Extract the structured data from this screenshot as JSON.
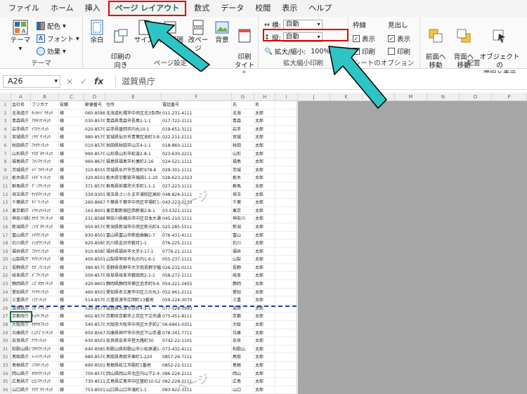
{
  "tabs": [
    "ファイル",
    "ホーム",
    "挿入",
    "ページ レイアウト",
    "数式",
    "データ",
    "校閲",
    "表示",
    "ヘルプ"
  ],
  "active_tab_index": 3,
  "ribbon": {
    "theme": {
      "label": "テーマ",
      "colors": "配色",
      "fonts": "フォント",
      "effects": "効果",
      "group": "テーマ"
    },
    "page_setup": {
      "margins": "余白",
      "orientation": "印刷の\n向き",
      "size": "サイズ",
      "print_area": "印刷範囲",
      "breaks": "改ページ",
      "background": "背景",
      "print_titles": "印刷\nタイトル",
      "group": "ページ設定"
    },
    "scale": {
      "width_label": "横:",
      "width_value": "自動",
      "height_label": "縦:",
      "height_value": "自動",
      "scale_label": "拡大/縮小:",
      "scale_value": "100%",
      "group": "拡大縮小印刷"
    },
    "sheet_options": {
      "gridlines": "枠線",
      "headings": "見出し",
      "view": "表示",
      "print": "印刷",
      "group": "シートのオプション"
    },
    "arrange": {
      "bring_forward": "前面へ\n移動",
      "send_backward": "背面へ\n移動",
      "selection_pane": "オブジェクトの\n選択と表示",
      "group": "配置"
    }
  },
  "formula_bar": {
    "namebox": "A26",
    "icons": [
      "×",
      "✓",
      "fx"
    ],
    "value": "滋賀県庁"
  },
  "columns": [
    "A",
    "B",
    "C",
    "D",
    "E",
    "F",
    "G",
    "H",
    "I",
    "J",
    "K",
    "L",
    "M",
    "N",
    "O",
    "P"
  ],
  "headers": [
    "会社名",
    "フリガナ",
    "役職",
    "郵便番号",
    "住所",
    "電話番号",
    "氏",
    "名"
  ],
  "rows": [
    [
      "北海道庁",
      "ﾎｯｶｲﾄﾞｳﾁｮｳ",
      "様",
      "060-8588",
      "北海道札幌市中央区北3条西6丁目",
      "011-231-4111",
      "北海",
      "太郎"
    ],
    [
      "青森県庁",
      "ｱｵﾓﾘｹﾝﾁｮｳ",
      "様",
      "030-8570",
      "青森県青森市長島1-1-1",
      "017-722-1111",
      "青森",
      "太郎"
    ],
    [
      "岩手県庁",
      "ｲﾜﾃｹﾝﾁｮｳ",
      "様",
      "020-8570",
      "岩手県盛岡市内丸10-1",
      "019-651-3111",
      "岩手",
      "太郎"
    ],
    [
      "宮城県庁",
      "ﾐﾔｷﾞｹﾝﾁｮｳ",
      "様",
      "980-8570",
      "宮城県仙台市青葉区本町3-8-1",
      "022-211-2111",
      "宮城",
      "太郎"
    ],
    [
      "秋田県庁",
      "ｱｷﾀｹﾝﾁｮｳ",
      "様",
      "010-8570",
      "秋田県秋田市山王4-1-1",
      "018-860-1111",
      "秋田",
      "太郎"
    ],
    [
      "山形県庁",
      "ﾔﾏｶﾞﾀｹﾝﾁｮｳ",
      "様",
      "990-8570",
      "山形県山形市松波2-8-1",
      "023-630-2211",
      "山形",
      "太郎"
    ],
    [
      "福島県庁",
      "ﾌｸｼﾏｹﾝﾁｮｳ",
      "様",
      "960-8670",
      "福島県福島市杉妻町2-16",
      "024-521-1111",
      "福島",
      "太郎"
    ],
    [
      "茨城県庁",
      "ｲﾊﾞﾗｷｹﾝﾁｮｳ",
      "様",
      "310-8555",
      "茨城県水戸市笠原町978-6",
      "029-301-1111",
      "茨城",
      "太郎"
    ],
    [
      "栃木県庁",
      "ﾄﾁｷﾞｹﾝﾁｮｳ",
      "様",
      "320-8501",
      "栃木県宇都宮市塙田1-1-20",
      "028-623-2323",
      "栃木",
      "太郎"
    ],
    [
      "群馬県庁",
      "ｸﾞﾝﾏｹﾝﾁｮｳ",
      "様",
      "371-8570",
      "群馬県前橋市大手町1-1-1",
      "027-223-1111",
      "群馬",
      "太郎"
    ],
    [
      "埼玉県庁",
      "ｻｲﾀﾏｹﾝﾁｮｳ",
      "様",
      "330-9301",
      "埼玉県さいたま市浦和区高砂3-15-1",
      "048-824-2111",
      "埼玉",
      "太郎"
    ],
    [
      "千葉県庁",
      "ﾁﾊﾞｹﾝﾁｮｳ",
      "様",
      "260-8667",
      "千葉県千葉市中央区市場町1-1",
      "043-223-2110",
      "千葉",
      "太郎"
    ],
    [
      "東京都庁",
      "ﾄｳｷｮｳﾄﾁｮｳ",
      "様",
      "163-8001",
      "東京都新宿区西新宿2-8-1",
      "03-5321-1111",
      "東京",
      "太郎"
    ],
    [
      "神奈川県庁",
      "ｶﾅｶﾞﾜｹﾝﾁｮｳ",
      "様",
      "231-8588",
      "神奈川県横浜市中区日本大通1",
      "045-210-1111",
      "神奈川",
      "太郎"
    ],
    [
      "新潟県庁",
      "ﾆｲｶﾞﾀｹﾝﾁｮｳ",
      "様",
      "950-8570",
      "新潟県新潟市中央区新光町4-1",
      "025-285-5511",
      "新潟",
      "太郎"
    ],
    [
      "富山県庁",
      "ﾄﾔﾏｹﾝﾁｮｳ",
      "様",
      "930-8501",
      "富山県富山市新総曲輪1-7",
      "076-431-4111",
      "富山",
      "太郎"
    ],
    [
      "石川県庁",
      "ｲｼｶﾜｹﾝﾁｮｳ",
      "様",
      "920-8580",
      "石川県金沢市鞍月1-1",
      "076-225-1111",
      "石川",
      "太郎"
    ],
    [
      "福井県庁",
      "ﾌｸｲｹﾝﾁｮｳ",
      "様",
      "910-8580",
      "福井県福井市大手3-17-1",
      "0776-21-1111",
      "福井",
      "太郎"
    ],
    [
      "山梨県庁",
      "ﾔﾏﾅｼｹﾝﾁｮｳ",
      "様",
      "400-8501",
      "山梨県甲府市丸の内1-6-1",
      "055-237-1111",
      "山梨",
      "太郎"
    ],
    [
      "長野県庁",
      "ﾅｶﾞﾉｹﾝﾁｮｳ",
      "様",
      "380-8570",
      "長野県長野市大字南長野字幅下692-2",
      "026-232-0111",
      "長野",
      "太郎"
    ],
    [
      "岐阜県庁",
      "ｷﾞﾌｹﾝﾁｮｳ",
      "様",
      "500-8570",
      "岐阜県岐阜市薮田南2-1-1",
      "058-272-1111",
      "岐阜",
      "太郎"
    ],
    [
      "静岡県庁",
      "ｼｽﾞｵｶｹﾝﾁｮｳ",
      "様",
      "420-8601",
      "静岡県静岡市葵区追手町9-6",
      "054-221-2455",
      "静岡",
      "太郎"
    ],
    [
      "愛知県庁",
      "ｱｲﾁｹﾝﾁｮｳ",
      "様",
      "460-8501",
      "愛知県名古屋市中区三の丸3-1-2",
      "052-961-2111",
      "愛知",
      "太郎"
    ],
    [
      "三重県庁",
      "ﾐｴｹﾝﾁｮｳ",
      "様",
      "514-8570",
      "三重県津市広明町13番地",
      "059-224-3070",
      "三重",
      "太郎"
    ],
    [
      "滋賀県庁",
      "ｼｶﾞｹﾝﾁｮｳ",
      "様",
      "520-8577",
      "滋賀県大津市京町4-1-1",
      "077-528-3993",
      "滋賀",
      "太郎"
    ],
    [
      "京都府庁",
      "ｷｮｳﾄﾌﾁｮｳ",
      "様",
      "602-8570",
      "京都府京都市上京区下立売通新町西入薮ノ内町",
      "075-451-8111",
      "京都",
      "太郎"
    ],
    [
      "大阪府庁",
      "ｵｵｻｶﾌﾁｮｳ",
      "様",
      "540-8570",
      "大阪府大阪市中央区大手前2丁目",
      "06-6941-0351",
      "大阪",
      "太郎"
    ],
    [
      "兵庫県庁",
      "ﾋｮｳｺﾞｹﾝﾁｮｳ",
      "様",
      "650-8567",
      "兵庫県神戸市中央区下山手通5-10-1",
      "078-341-7711",
      "兵庫",
      "太郎"
    ],
    [
      "奈良県庁",
      "ﾅﾗｹﾝﾁｮｳ",
      "様",
      "630-8501",
      "奈良県奈良市登大路町30",
      "0742-22-1101",
      "奈良",
      "太郎"
    ],
    [
      "和歌山県庁",
      "ﾜｶﾔﾏｹﾝﾁｮｳ",
      "様",
      "640-8585",
      "和歌山県和歌山市小松原通1-1",
      "073-432-4111",
      "和歌山",
      "太郎"
    ],
    [
      "鳥取県庁",
      "ﾄｯﾄﾘｹﾝﾁｮｳ",
      "様",
      "680-8570",
      "鳥取県鳥取市東町1-220",
      "0857-26-7111",
      "鳥取",
      "太郎"
    ],
    [
      "島根県庁",
      "ｼﾏﾈｹﾝﾁｮｳ",
      "様",
      "690-8501",
      "島根県松江市殿町1番地",
      "0852-22-5111",
      "島根",
      "太郎"
    ],
    [
      "岡山県庁",
      "ｵｶﾔﾏｹﾝﾁｮｳ",
      "様",
      "700-8570",
      "岡山県岡山市北区内山下2-4-6",
      "086-224-2111",
      "岡山",
      "太郎"
    ],
    [
      "広島県庁",
      "ﾋﾛｼﾏｹﾝﾁｮｳ",
      "様",
      "730-8511",
      "広島県広島市中区基町10-52",
      "082-228-2111",
      "広島",
      "太郎"
    ],
    [
      "山口県庁",
      "ﾔﾏｸﾞﾁｹﾝﾁｮｳ",
      "様",
      "753-8501",
      "山口県山口市滝町1-1",
      "083-922-3111",
      "山口",
      "太郎"
    ],
    [
      "徳島県庁",
      "ﾄｸｼﾏｹﾝﾁｮｳ",
      "様",
      "770-8570",
      "徳島県徳島市万代町1-1",
      "088-621-2500",
      "徳島",
      "太郎"
    ]
  ],
  "watermark": "ページ"
}
